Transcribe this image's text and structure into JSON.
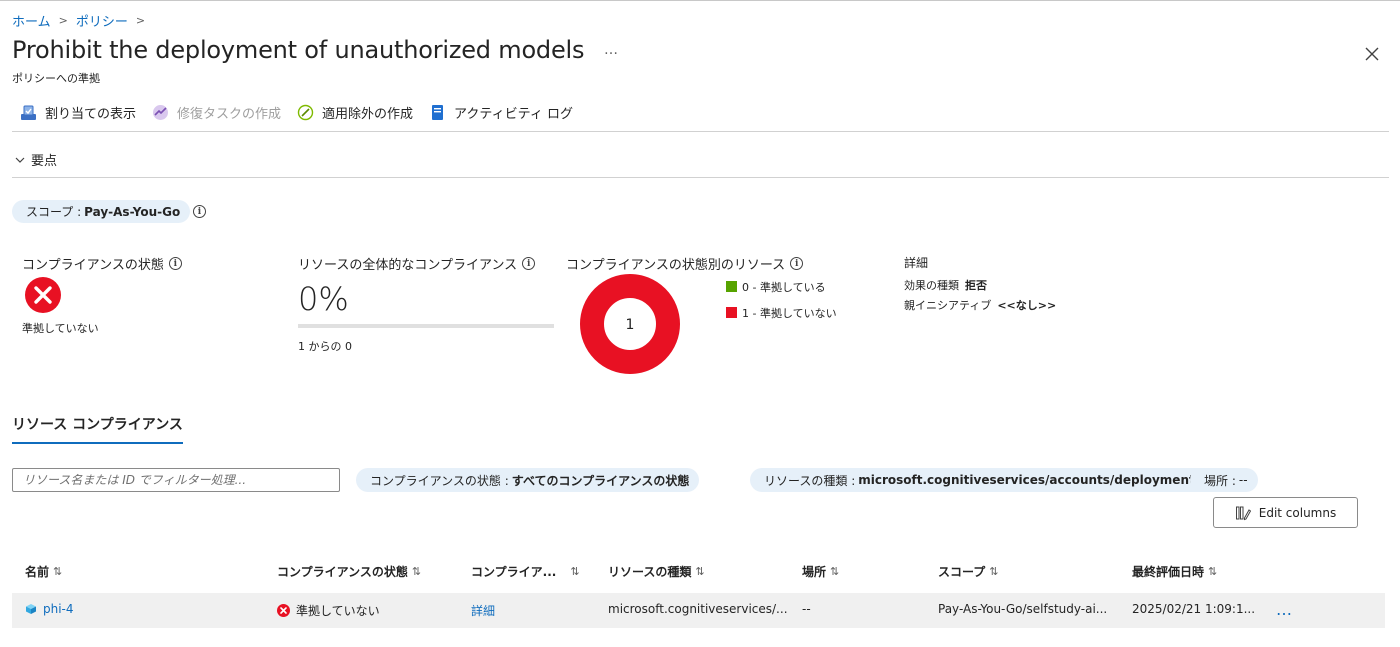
{
  "breadcrumb": {
    "home": "ホーム",
    "policy": "ポリシー"
  },
  "page": {
    "title": "Prohibit the deployment of unauthorized models",
    "more": "…",
    "subtitle": "ポリシーへの準拠"
  },
  "toolbar": {
    "view_assignment": "割り当ての表示",
    "create_remediation": "修復タスクの作成",
    "create_exemption": "適用除外の作成",
    "activity_log": "アクティビティ ログ"
  },
  "essentials": {
    "label": "要点"
  },
  "scope": {
    "label": "スコープ :",
    "value": "Pay-As-You-Go"
  },
  "compliance_state": {
    "title": "コンプライアンスの状態",
    "value": "準拠していない"
  },
  "overall": {
    "title": "リソースの全体的なコンプライアンス",
    "percent": "0%",
    "fraction": 0,
    "of_text": "1 からの 0"
  },
  "by_state": {
    "title": "コンプライアンスの状態別のリソース",
    "center": "1",
    "legend": [
      {
        "label": "0 - 準拠している",
        "color": "#57a300"
      },
      {
        "label": "1 - 準拠していない",
        "color": "#e81123"
      }
    ]
  },
  "details": {
    "title": "詳細",
    "effect_label": "効果の種類",
    "effect_value": "拒否",
    "initiative_label": "親イニシアティブ",
    "initiative_value": "<<なし>>"
  },
  "tab": {
    "label": "リソース コンプライアンス"
  },
  "filters": {
    "search_placeholder": "リソース名または ID でフィルター処理...",
    "state_label": "コンプライアンスの状態 :",
    "state_value": "すべてのコンプライアンスの状態",
    "type_label": "リソースの種類 :",
    "type_value": "microsoft.cognitiveservices/accounts/deployments",
    "location_label": "場所 :",
    "location_value": "--"
  },
  "edit_columns": "Edit columns",
  "table": {
    "headers": [
      "名前",
      "コンプライアンスの状態",
      "コンプライア...",
      "リソースの種類",
      "場所",
      "スコープ",
      "最終評価日時"
    ],
    "rows": [
      {
        "name": "phi-4",
        "state": "準拠していない",
        "compliance_link": "詳細",
        "type": "microsoft.cognitiveservices/...",
        "location": "--",
        "scope": "Pay-As-You-Go/selfstudy-ai...",
        "last_eval": "2025/02/21 1:09:1...",
        "more": "…"
      }
    ]
  },
  "colors": {
    "accent": "#0f6cbd",
    "error": "#e81123",
    "success": "#57a300"
  }
}
